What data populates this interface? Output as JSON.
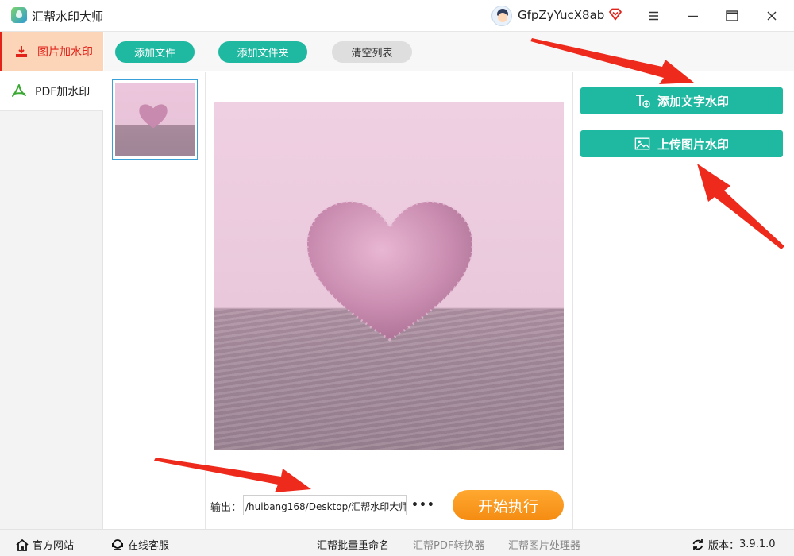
{
  "app": {
    "title": "汇帮水印大师",
    "logo_icon": "app-logo-icon"
  },
  "user": {
    "name": "GfpZyYucX8ab",
    "vip_icon": "diamond-icon"
  },
  "window_controls": [
    "menu-icon",
    "minimize-icon",
    "maximize-icon",
    "close-icon"
  ],
  "sidebar": {
    "items": [
      {
        "label": "图片加水印",
        "icon": "image-watermark-icon",
        "active": true
      },
      {
        "label": "PDF加水印",
        "icon": "pdf-icon",
        "active": false
      }
    ]
  },
  "toolbar": {
    "add_file_label": "添加文件",
    "add_folder_label": "添加文件夹",
    "clear_list_label": "清空列表"
  },
  "right_panel": {
    "add_text_watermark_label": "添加文字水印",
    "upload_image_watermark_label": "上传图片水印"
  },
  "output": {
    "label": "输出：",
    "path": "/huibang168/Desktop/汇帮水印大师",
    "more_label": "•••",
    "start_label": "开始执行"
  },
  "footer": {
    "website_label": "官方网站",
    "support_label": "在线客服",
    "rename_label": "汇帮批量重命名",
    "pdf_converter_label": "汇帮PDF转换器",
    "image_processor_label": "汇帮图片处理器",
    "version_label": "版本：",
    "version_value": "3.9.1.0"
  },
  "colors": {
    "accent_green": "#1fb8a0",
    "start_orange": "#f58c12",
    "active_red": "#e2231a",
    "active_bg": "#fcd5b9",
    "arrow_red": "#ee2a1c"
  }
}
